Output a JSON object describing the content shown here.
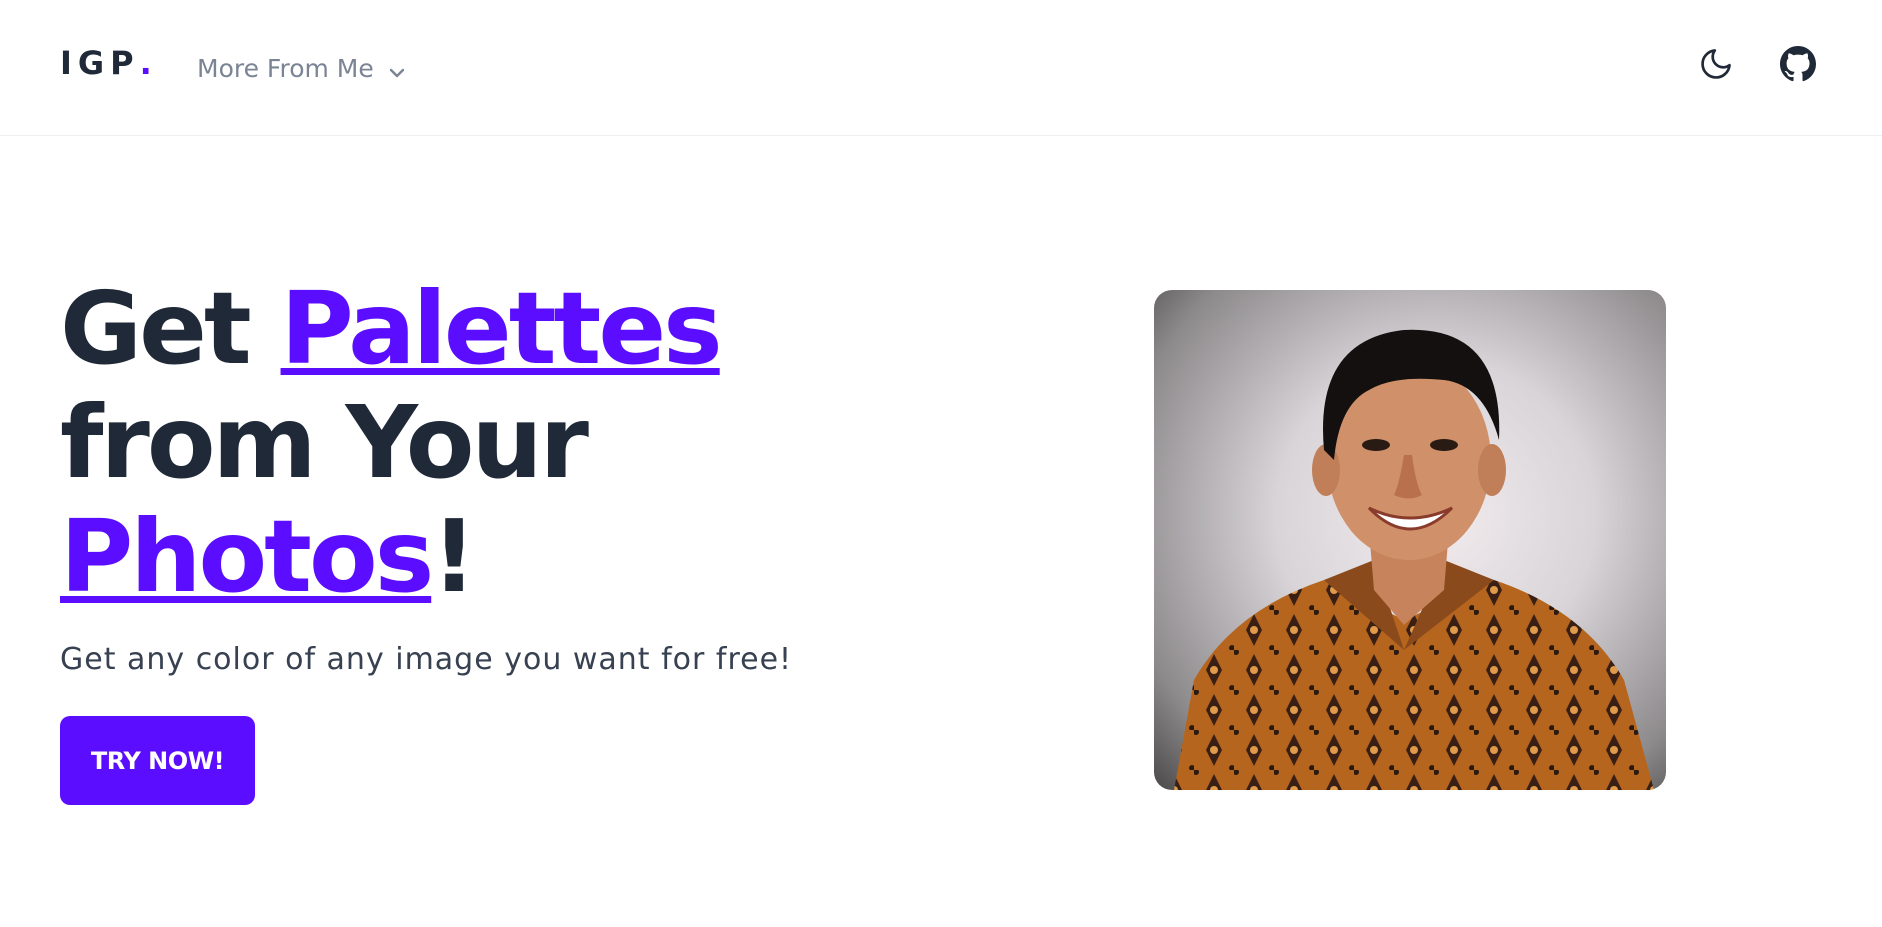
{
  "header": {
    "logo_text": "IGP",
    "logo_dot": ".",
    "menu_label": "More From Me",
    "menu_icon": "chevron-down-icon",
    "theme_icon": "moon-icon",
    "repo_icon": "github-icon"
  },
  "hero": {
    "title_get": "Get",
    "title_palettes": "Palettes",
    "title_from_your": "from Your",
    "title_photos": "Photos",
    "title_exclaim": "!",
    "subtitle": "Get any color of any image you want for free!",
    "cta_label": "TRY NOW!"
  },
  "colors": {
    "accent": "#5b0eff",
    "text_dark": "#1f2937",
    "text_muted": "#7b8495"
  }
}
